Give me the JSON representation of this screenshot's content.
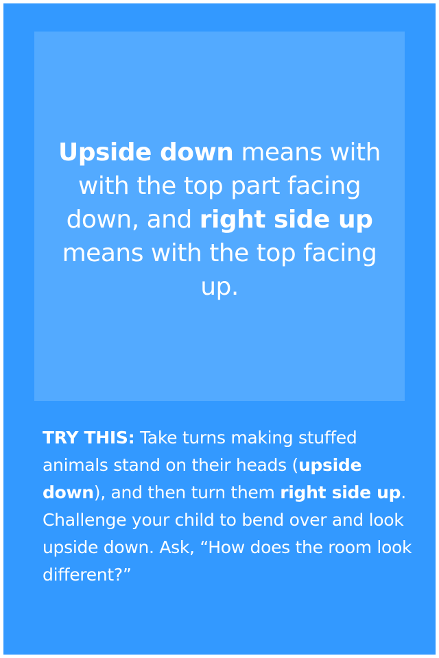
{
  "definition": {
    "term1": "Upside down",
    "text1": " means with with the top part facing down, and ",
    "term2": "right side up",
    "text2": " means with the top facing up."
  },
  "tip": {
    "label": "TRY THIS:",
    "text1": " Take turns making stuffed animals stand on their heads (",
    "term1": "upside down",
    "text2": "), and then turn them ",
    "term2": "right side up",
    "text3": ". Challenge your child to bend over and look upside down.  Ask, “How does the room look different?”"
  },
  "colors": {
    "frame_background": "#3399ff",
    "definition_background": "#53aaff",
    "text": "#ffffff"
  }
}
